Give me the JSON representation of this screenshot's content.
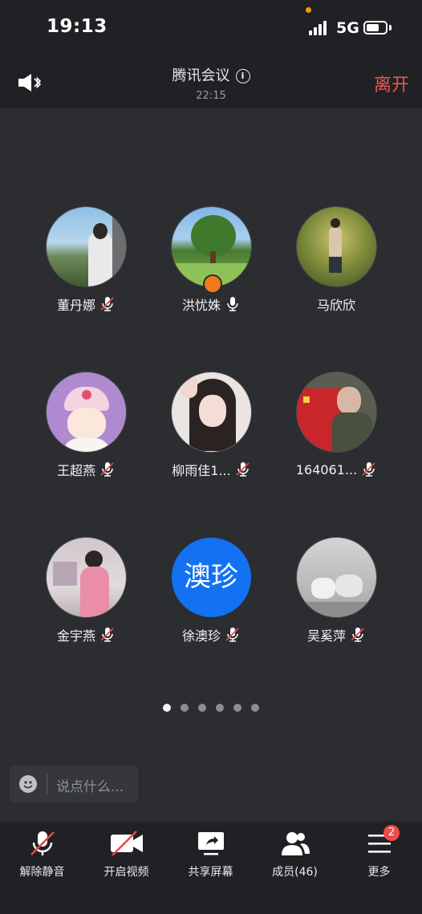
{
  "status_bar": {
    "time": "19:13",
    "network": "5G",
    "battery_level": 0.7
  },
  "header": {
    "title": "腾讯会议",
    "timer": "22:15",
    "leave_label": "离开"
  },
  "participants": [
    {
      "name": "董丹娜",
      "muted": true
    },
    {
      "name": "洪忧姝",
      "muted": false,
      "host": true
    },
    {
      "name": "马欣欣",
      "muted": null
    },
    {
      "name": "王超燕",
      "muted": true
    },
    {
      "name": "柳雨佳1...",
      "muted": true
    },
    {
      "name": "164061...",
      "muted": true
    },
    {
      "name": "金宇燕",
      "muted": true
    },
    {
      "name": "徐澳珍",
      "muted": true,
      "avatar_text": "澳珍"
    },
    {
      "name": "吴奚萍",
      "muted": true
    }
  ],
  "pager": {
    "pages": 6,
    "current": 1
  },
  "chat": {
    "placeholder": "说点什么..."
  },
  "toolbar": {
    "unmute": "解除静音",
    "video": "开启视频",
    "share": "共享屏幕",
    "members": "成员(46)",
    "more": "更多",
    "more_badge": "2"
  },
  "colors": {
    "leave": "#f05454",
    "avatar_blue": "#1272f2",
    "host_badge": "#f07a1a",
    "badge": "#f04a4a"
  }
}
